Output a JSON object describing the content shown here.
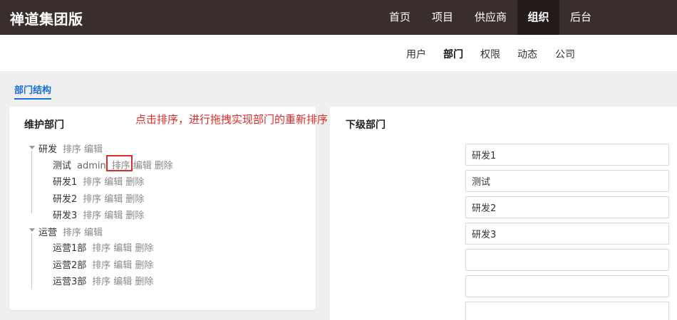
{
  "header": {
    "brand": "禅道集团版",
    "nav": [
      {
        "label": "首页",
        "active": false
      },
      {
        "label": "项目",
        "active": false
      },
      {
        "label": "供应商",
        "active": false
      },
      {
        "label": "组织",
        "active": true
      },
      {
        "label": "后台",
        "active": false
      }
    ]
  },
  "subnav": [
    {
      "label": "用户",
      "active": false
    },
    {
      "label": "部门",
      "active": true
    },
    {
      "label": "权限",
      "active": false
    },
    {
      "label": "动态",
      "active": false
    },
    {
      "label": "公司",
      "active": false
    }
  ],
  "section_tab": "部门结构",
  "annotation": "点击排序，进行拖拽实现部门的重新排序",
  "left_panel": {
    "title": "维护部门",
    "actions": {
      "sort": "排序",
      "edit": "编辑",
      "delete": "删除"
    },
    "groups": [
      {
        "name": "研发",
        "children": [
          {
            "name": "测试",
            "manager": "admin"
          },
          {
            "name": "研发1",
            "manager": ""
          },
          {
            "name": "研发2",
            "manager": ""
          },
          {
            "name": "研发3",
            "manager": ""
          }
        ]
      },
      {
        "name": "运营",
        "children": [
          {
            "name": "运营1部",
            "manager": ""
          },
          {
            "name": "运营2部",
            "manager": ""
          },
          {
            "name": "运营3部",
            "manager": ""
          }
        ]
      }
    ]
  },
  "right_panel": {
    "title": "下级部门",
    "inputs": [
      "研发1",
      "测试",
      "研发2",
      "研发3",
      "",
      "",
      ""
    ]
  }
}
